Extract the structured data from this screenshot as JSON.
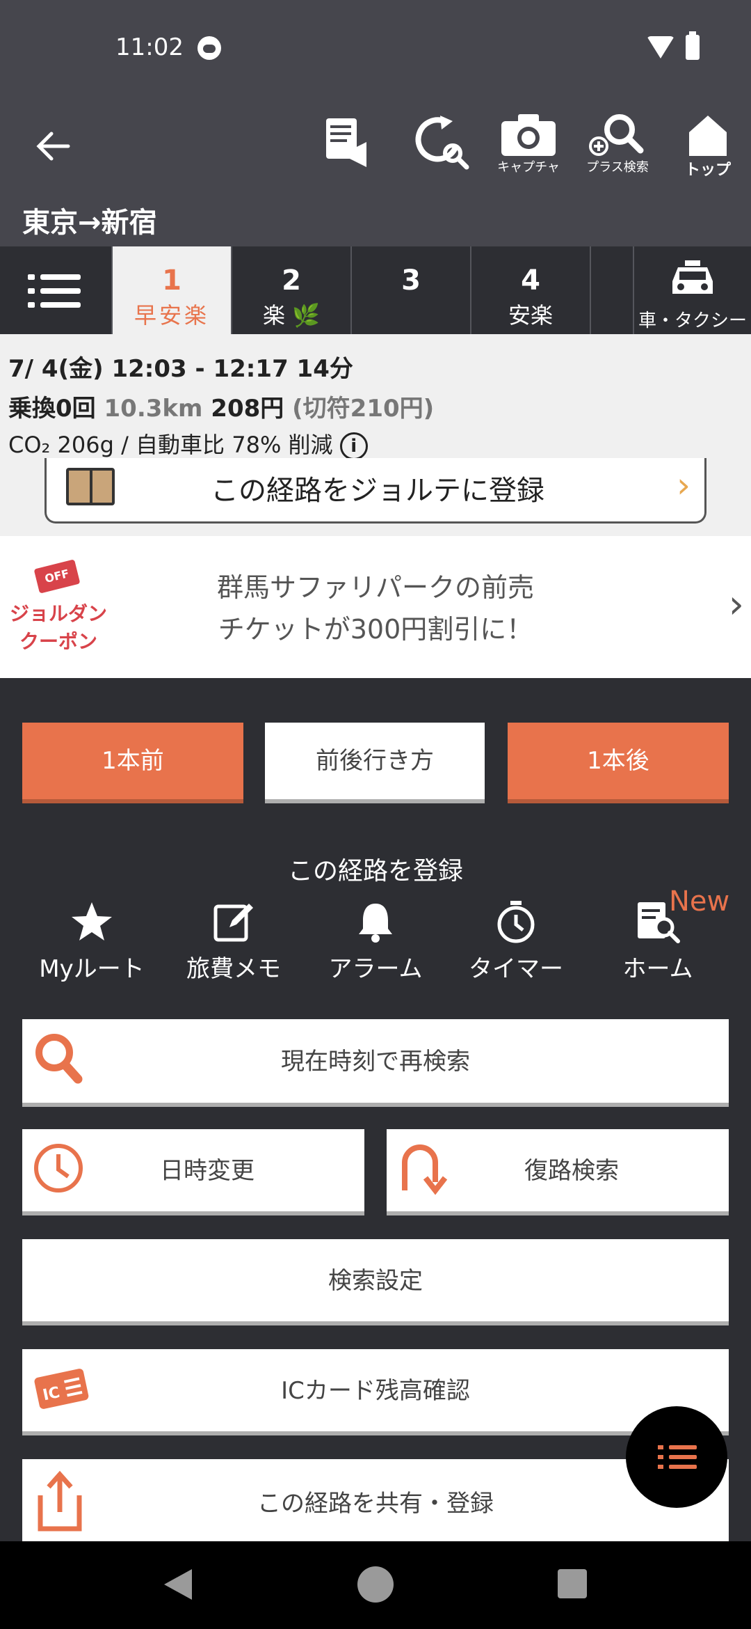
{
  "status_bar": {
    "time": "11:02"
  },
  "toolbar": {
    "capture_label": "キャプチャ",
    "plus_search_label": "プラス検索",
    "top_label": "トップ"
  },
  "route_title": "東京→新宿",
  "tabs": [
    {
      "num": "1",
      "sub": "早安楽"
    },
    {
      "num": "2",
      "sub": "楽 🌿"
    },
    {
      "num": "3",
      "sub": ""
    },
    {
      "num": "4",
      "sub": "安楽"
    }
  ],
  "car_tab_label": "車・タクシー",
  "summary": {
    "line1": "7/ 4(金) 12:03 - 12:17 14分",
    "transfers": "乗換0回",
    "distance": "10.3km",
    "fare": "208円",
    "ticket_fare": "(切符210円)",
    "co2": "CO₂ 206g / 自動車比 78% 削減",
    "info_glyph": "i"
  },
  "jorte_button": "この経路をジョルテに登録",
  "coupon": {
    "tag": "OFF",
    "brand_line1": "ジョルダン",
    "brand_line2": "クーポン",
    "message_line1": "群馬サファリパークの前売",
    "message_line2": "チケットが300円割引に！"
  },
  "nav_buttons": {
    "prev": "1本前",
    "around": "前後行き方",
    "next": "1本後"
  },
  "register": {
    "title": "この経路を登録",
    "items": [
      "Myルート",
      "旅費メモ",
      "アラーム",
      "タイマー",
      "ホーム"
    ],
    "new_badge": "New"
  },
  "actions": {
    "research_now": "現在時刻で再検索",
    "change_datetime": "日時変更",
    "return_search": "復路検索",
    "search_settings": "検索設定",
    "ic_balance": "ICカード残高確認",
    "share_register": "この経路を共有・登録"
  },
  "colors": {
    "accent": "#e8734c",
    "header": "#46464d",
    "body_bg": "#2d2e33",
    "coupon_red": "#d8434a"
  }
}
